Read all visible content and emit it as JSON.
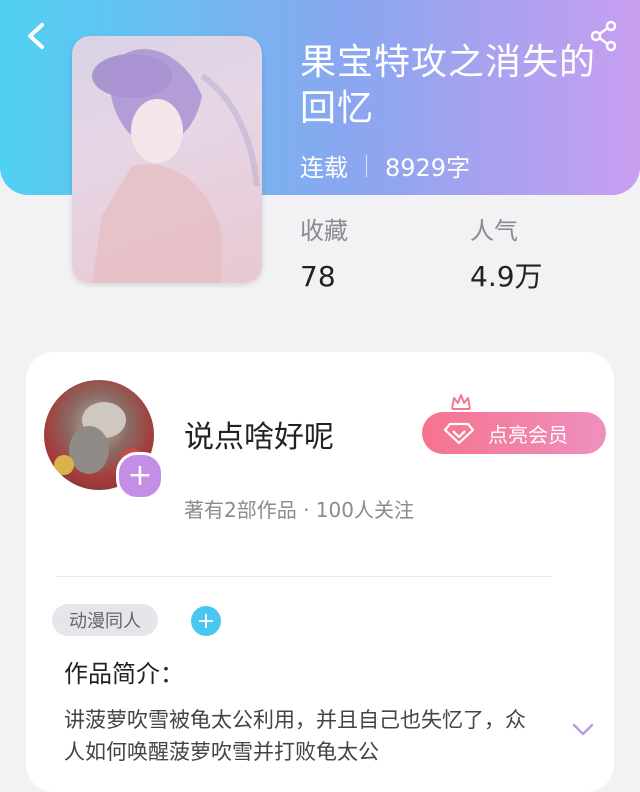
{
  "book": {
    "title": "果宝特攻之消失的回忆",
    "status": "连载",
    "word_count": "8929字"
  },
  "stats": {
    "favorites_label": "收藏",
    "favorites_value": "78",
    "popularity_label": "人气",
    "popularity_value": "4.9万"
  },
  "author": {
    "name": "说点啥好呢",
    "summary": "著有2部作品 · 100人关注",
    "member_button_label": "点亮会员"
  },
  "tags": {
    "items": [
      "动漫同人"
    ]
  },
  "intro": {
    "title": "作品简介：",
    "text": "讲菠萝吹雪被龟太公利用，并且自己也失忆了，众人如何唤醒菠萝吹雪并打败龟太公"
  },
  "icons": {
    "back": "chevron-left-icon",
    "share": "share-icon",
    "avatar_add": "plus-icon",
    "member": "diamond-icon",
    "crown": "crown-icon",
    "tag_add": "plus-icon",
    "expand": "chevron-down-icon"
  },
  "colors": {
    "header_gradient_start": "#4fd1f2",
    "header_gradient_end": "#c89ef0",
    "member_button_start": "#f6738c",
    "member_button_end": "#ee90c0",
    "accent_purple": "#c58ee6",
    "accent_blue": "#49c7f0"
  }
}
